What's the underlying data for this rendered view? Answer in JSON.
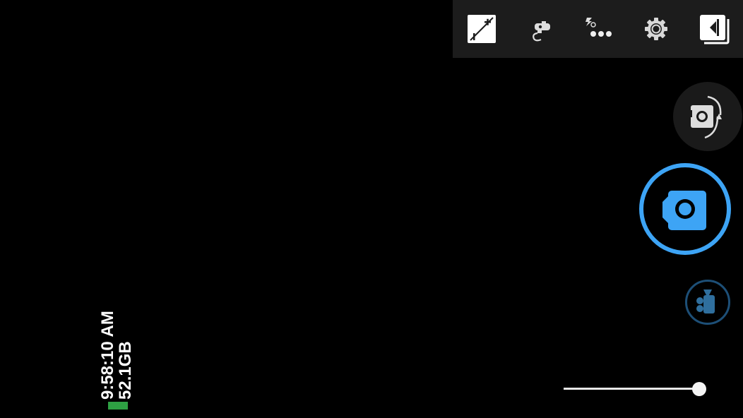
{
  "status": {
    "time": "9:58:10 AM",
    "storage": "52.1GB",
    "battery_color": "#2ea043"
  },
  "toolbar": {
    "icons": [
      "exposure-icon",
      "white-balance-icon",
      "flash-more-icon",
      "settings-icon",
      "gallery-icon"
    ]
  },
  "controls": {
    "switch_camera_icon": "switch-camera-icon",
    "shutter_icon": "camera-icon",
    "video_icon": "video-camera-icon",
    "accent_color": "#3da4f5"
  },
  "zoom": {
    "level": 0.94
  }
}
